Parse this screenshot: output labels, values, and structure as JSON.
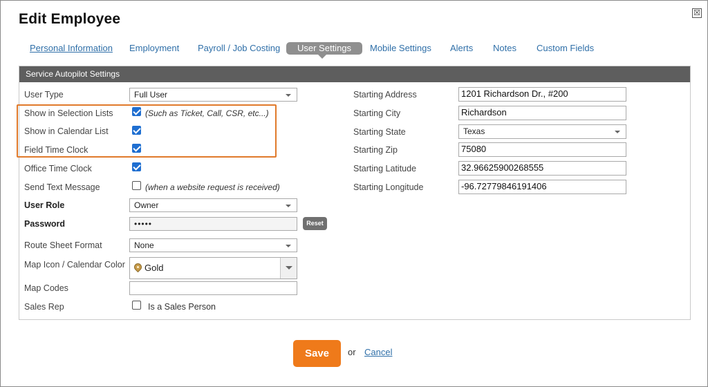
{
  "dialog": {
    "title": "Edit Employee",
    "close_label": "☒"
  },
  "tabs": [
    {
      "label": "Personal Information"
    },
    {
      "label": "Employment"
    },
    {
      "label": "Payroll / Job Costing"
    },
    {
      "label": "User Settings",
      "active": true
    },
    {
      "label": "Mobile Settings"
    },
    {
      "label": "Alerts"
    },
    {
      "label": "Notes"
    },
    {
      "label": "Custom Fields"
    }
  ],
  "panel": {
    "header": "Service Autopilot Settings"
  },
  "left": {
    "user_type": {
      "label": "User Type",
      "value": "Full User"
    },
    "show_selection": {
      "label": "Show in Selection Lists",
      "checked": true,
      "note": "(Such as Ticket, Call, CSR, etc...)"
    },
    "show_calendar": {
      "label": "Show in Calendar List",
      "checked": true
    },
    "field_time_clock": {
      "label": "Field Time Clock",
      "checked": true
    },
    "office_time_clock": {
      "label": "Office Time Clock",
      "checked": true
    },
    "send_text": {
      "label": "Send Text Message",
      "checked": false,
      "note": "(when a website request is received)"
    },
    "user_role": {
      "label": "User Role",
      "value": "Owner"
    },
    "password": {
      "label": "Password",
      "value": "•••••",
      "reset_label": "Reset"
    },
    "route_sheet": {
      "label": "Route Sheet Format",
      "value": "None"
    },
    "map_icon": {
      "label": "Map Icon / Calendar Color",
      "value": "Gold"
    },
    "map_codes": {
      "label": "Map Codes",
      "value": ""
    },
    "sales_rep": {
      "label": "Sales Rep",
      "checked": false,
      "text": "Is a Sales Person"
    }
  },
  "right": {
    "address": {
      "label": "Starting Address",
      "value": "1201 Richardson Dr., #200"
    },
    "city": {
      "label": "Starting City",
      "value": "Richardson"
    },
    "state": {
      "label": "Starting State",
      "value": "Texas"
    },
    "zip": {
      "label": "Starting Zip",
      "value": "75080"
    },
    "latitude": {
      "label": "Starting Latitude",
      "value": "32.96625900268555"
    },
    "longitude": {
      "label": "Starting Longitude",
      "value": "-96.72779846191406"
    }
  },
  "footer": {
    "save_label": "Save",
    "or_text": "or",
    "cancel_label": "Cancel"
  },
  "colors": {
    "accent": "#ef7a1a",
    "highlight": "#e07a2b",
    "link": "#2f6fa8",
    "checkbox": "#1f6fd1",
    "header_bg": "#5e5e5e"
  }
}
